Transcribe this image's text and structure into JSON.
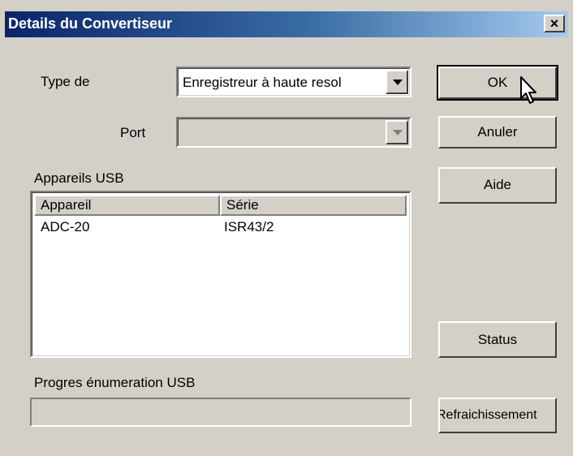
{
  "window": {
    "title": "Details du Convertiseur",
    "close_label": "×"
  },
  "form": {
    "type_label": "Type de",
    "type_value": "Enregistreur  à haute resol",
    "port_label": "Port",
    "port_value": "",
    "usb_devices_label": "Appareils USB",
    "progress_label": "Progres énumeration USB",
    "progress_value": 0
  },
  "devices_table": {
    "columns": [
      "Appareil",
      "Série"
    ],
    "rows": [
      {
        "device": "ADC-20",
        "serial": "ISR43/2"
      }
    ]
  },
  "buttons": {
    "ok": "OK",
    "cancel": "Anuler",
    "help": "Aide",
    "status": "Status",
    "refresh": "Refraichissement"
  }
}
